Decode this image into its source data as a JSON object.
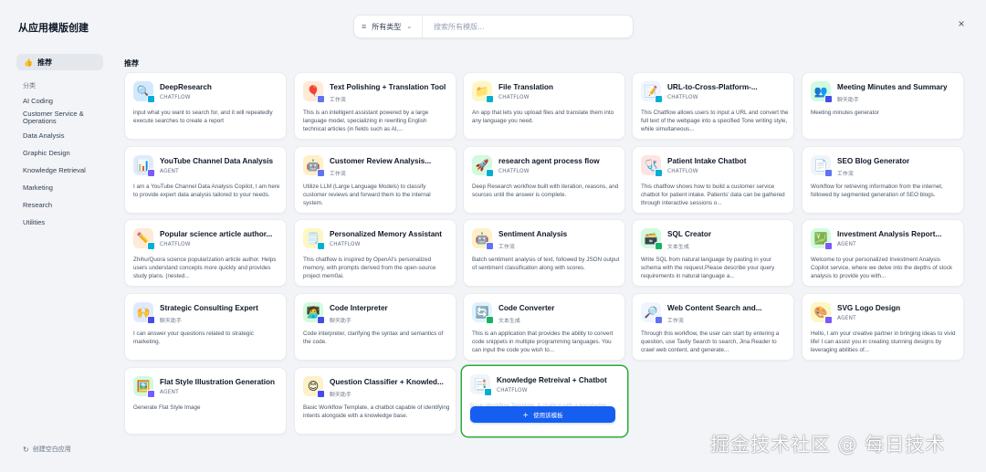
{
  "header": {
    "title": "从应用模版创建",
    "filter_label": "所有类型",
    "search_placeholder": "搜索所有模版...",
    "close_icon": "×"
  },
  "sidebar": {
    "recommended": "推荐",
    "category_heading": "分类",
    "categories": [
      "AI Coding",
      "Customer Service & Operations",
      "Data Analysis",
      "Graphic Design",
      "Knowledge Retrieval",
      "Marketing",
      "Research",
      "Utilities"
    ],
    "create_blank": "创建空白应用"
  },
  "section_title": "推荐",
  "use_template_button": "使用该模板",
  "watermark": "掘金技术社区 @ 每日技术",
  "badge_colors": {
    "CHATFLOW": "#06aed4",
    "AGENT": "#7a5af8",
    "工作流": "#6172f3",
    "文本生成": "#16b364",
    "聊天助手": "#444ce7"
  },
  "cards": [
    {
      "name": "DeepResearch",
      "type": "CHATFLOW",
      "icon": "🔍",
      "icon_bg": "#d1e9ff",
      "desc": "input what you want to search for, and it will repeatedly execute searches to create a report"
    },
    {
      "name": "Text Polishing + Translation Tool",
      "type": "工作流",
      "icon": "🎈",
      "icon_bg": "#ffead5",
      "desc": "This is an intelligent assistant powered by a large language model, specializing in rewriting English technical articles (in fields such as AI,..."
    },
    {
      "name": "File Translation",
      "type": "CHATFLOW",
      "icon": "📁",
      "icon_bg": "#fef7c3",
      "desc": "An app that lets you upload files and translate them into any language you need."
    },
    {
      "name": "URL-to-Cross-Platform-...",
      "type": "CHATFLOW",
      "icon": "📝",
      "icon_bg": "#eff4ff",
      "desc": "This Chatflow allows users to input a URL and convert the full text of the webpage into a specified Tone writing style, while simultaneous..."
    },
    {
      "name": "Meeting Minutes and Summary",
      "type": "聊天助手",
      "icon": "👥",
      "icon_bg": "#d1fadf",
      "desc": "Meeting minutes generator"
    },
    {
      "name": "YouTube Channel Data Analysis",
      "type": "AGENT",
      "icon": "📊",
      "icon_bg": "#e0eaff",
      "desc": "I am a YouTube Channel Data Analysis Copilot, I am here to provide expert data analysis tailored to your needs."
    },
    {
      "name": "Customer Review Analysis...",
      "type": "工作流",
      "icon": "🤖",
      "icon_bg": "#fef0c7",
      "desc": "Utilize LLM (Large Language Models) to classify customer reviews and forward them to the internal system."
    },
    {
      "name": "research agent process flow",
      "type": "CHATFLOW",
      "icon": "🚀",
      "icon_bg": "#d1fadf",
      "desc": "Deep Research workflow built with iteration, reasons, and sources until the answer is complete."
    },
    {
      "name": "Patient Intake Chatbot",
      "type": "CHATFLOW",
      "icon": "🩺",
      "icon_bg": "#fee4e2",
      "desc": "This chatflow shows how to build a customer service chatbot for patient intake. Patients' data can be gathered through interactive sessions o..."
    },
    {
      "name": "SEO Blog Generator",
      "type": "工作流",
      "icon": "📄",
      "icon_bg": "#f2f4f7",
      "desc": "Workflow for retrieving information from the internet, followed by segmented generation of SEO blogs."
    },
    {
      "name": "Popular science article author...",
      "type": "CHATFLOW",
      "icon": "✏️",
      "icon_bg": "#ffead5",
      "desc": "Zhihu/Quora science popularization article author. Helps users understand concepts more quickly and provides study plans. (nested..."
    },
    {
      "name": "Personalized Memory Assistant",
      "type": "CHATFLOW",
      "icon": "🗒️",
      "icon_bg": "#fef7c3",
      "desc": "This chatflow is inspired by OpenAI's personalized memory, with prompts derived from the open-source project mem0ai."
    },
    {
      "name": "Sentiment Analysis",
      "type": "工作流",
      "icon": "🤖",
      "icon_bg": "#fef0c7",
      "desc": "Batch sentiment analysis of text, followed by JSON output of sentiment classification along with scores."
    },
    {
      "name": "SQL Creator",
      "type": "文本生成",
      "icon": "🗃️",
      "icon_bg": "#d1fadf",
      "desc": "Write SQL from natural language by pasting in your schema with the request.Please describe your query requirements in natural language a..."
    },
    {
      "name": "Investment Analysis Report...",
      "type": "AGENT",
      "icon": "💹",
      "icon_bg": "#d1fadf",
      "desc": "Welcome to your personalized Investment Analysis Copilot service, where we delve into the depths of stock analysis to provide you with..."
    },
    {
      "name": "Strategic Consulting Expert",
      "type": "聊天助手",
      "icon": "🙌",
      "icon_bg": "#e0eaff",
      "desc": "I can answer your questions related to strategic marketing."
    },
    {
      "name": "Code Interpreter",
      "type": "聊天助手",
      "icon": "🧑‍💻",
      "icon_bg": "#d1fadf",
      "desc": "Code interpreter, clarifying the syntax and semantics of the code."
    },
    {
      "name": "Code Converter",
      "type": "文本生成",
      "icon": "🔄",
      "icon_bg": "#e0f2fe",
      "desc": "This is an application that provides the ability to convert code snippets in multiple programming languages. You can input the code you wish to..."
    },
    {
      "name": "Web Content Search and...",
      "type": "工作流",
      "icon": "🔎",
      "icon_bg": "#eff4ff",
      "desc": "Through this workflow, the user can start by entering a question, use Tavily Search to search, Jina Reader to crawl web content, and generate..."
    },
    {
      "name": "SVG Logo Design",
      "type": "AGENT",
      "icon": "🎨",
      "icon_bg": "#fef7c3",
      "desc": "Hello, I am your creative partner in bringing ideas to vivid life! I can assist you in creating stunning designs by leveraging abilities of..."
    },
    {
      "name": "Flat Style Illustration Generation",
      "type": "AGENT",
      "icon": "🖼️",
      "icon_bg": "#d1fadf",
      "desc": "Generate Flat Style Image"
    },
    {
      "name": "Question Classifier + Knowled...",
      "type": "聊天助手",
      "icon": "😊",
      "icon_bg": "#fef0c7",
      "desc": "Basic Workflow Template, a chatbot capable of identifying intents alongside with a knowledge base."
    },
    {
      "name": "Knowledge Retreival + Chatbot",
      "type": "CHATFLOW",
      "icon": "📑",
      "icon_bg": "#f2f4f7",
      "desc": "Basic Workflow Template, A chatbot with a knowledge base.",
      "active": true
    }
  ]
}
